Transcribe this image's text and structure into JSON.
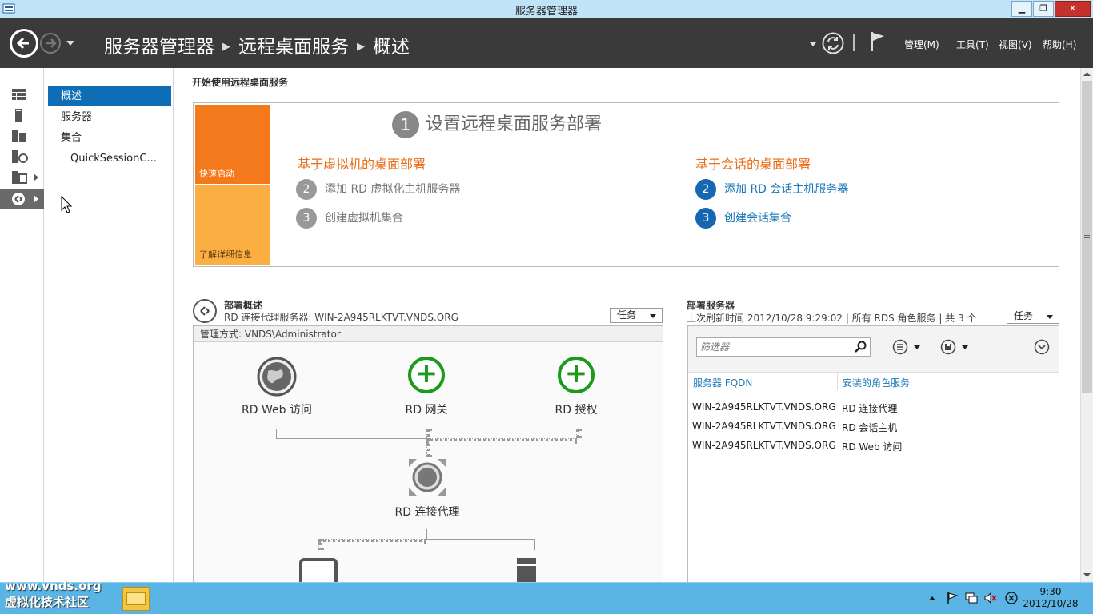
{
  "window": {
    "title": "服务器管理器",
    "minimize": "▁",
    "restore": "❐",
    "close": "✕"
  },
  "header": {
    "breadcrumb": [
      "服务器管理器",
      "远程桌面服务",
      "概述"
    ],
    "menus": [
      "管理(M)",
      "工具(T)",
      "视图(V)",
      "帮助(H)"
    ]
  },
  "nav": {
    "items": [
      "概述",
      "服务器",
      "集合",
      "QuickSessionC..."
    ],
    "selected": 0
  },
  "quickstart": {
    "section_title": "开始使用远程桌面服务",
    "tile_quick": "快速启动",
    "tile_learn": "了解详细信息",
    "step1_num": "1",
    "step1_label": "设置远程桌面服务部署",
    "vm_title": "基于虚拟机的桌面部署",
    "vm_step2_num": "2",
    "vm_step2_label": "添加 RD 虚拟化主机服务器",
    "vm_step3_num": "3",
    "vm_step3_label": "创建虚拟机集合",
    "session_title": "基于会话的桌面部署",
    "session_step2_num": "2",
    "session_step2_label": "添加 RD 会话主机服务器",
    "session_step3_num": "3",
    "session_step3_label": "创建会话集合"
  },
  "overview": {
    "title": "部署概述",
    "broker_line": "RD 连接代理服务器: WIN-2A945RLKTVT.VNDS.ORG",
    "task_label": "任务",
    "admin_line": "管理方式: VNDS\\Administrator",
    "roles": {
      "web": "RD Web 访问",
      "gateway": "RD 网关",
      "licensing": "RD 授权",
      "broker": "RD 连接代理"
    }
  },
  "servers": {
    "title": "部署服务器",
    "subtitle": "上次刷新时间 2012/10/28 9:29:02 | 所有 RDS 角色服务 | 共 3 个",
    "task_label": "任务",
    "filter_placeholder": "筛选器",
    "columns": [
      "服务器 FQDN",
      "安装的角色服务"
    ],
    "rows": [
      [
        "WIN-2A945RLKTVT.VNDS.ORG",
        "RD 连接代理"
      ],
      [
        "WIN-2A945RLKTVT.VNDS.ORG",
        "RD 会话主机"
      ],
      [
        "WIN-2A945RLKTVT.VNDS.ORG",
        "RD Web 访问"
      ]
    ]
  },
  "taskbar": {
    "watermark_line1": "www.vnds.org",
    "watermark_line2": "虚拟化技术社区",
    "time": "9:30",
    "date": "2012/10/28"
  },
  "colors": {
    "accent": "#0e6db5",
    "orange": "#f4791d",
    "light_orange": "#fbae42",
    "header_bg": "#3a3a3a"
  }
}
